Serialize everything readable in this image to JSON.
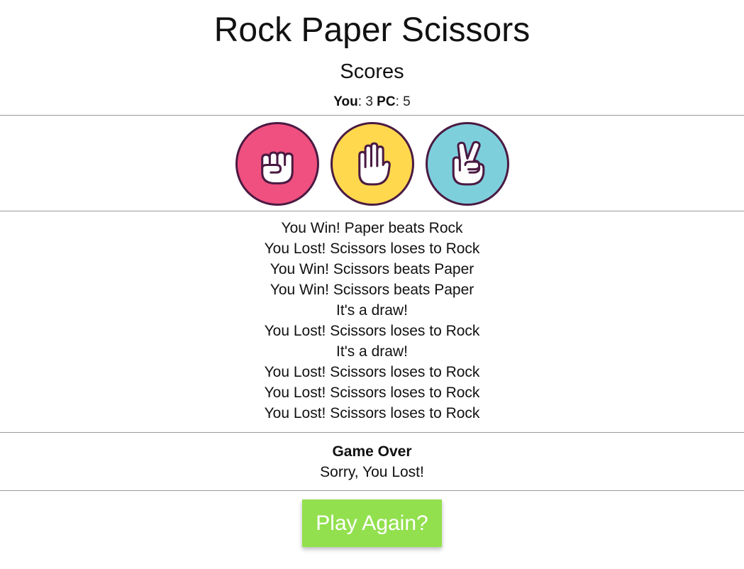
{
  "header": {
    "title": "Rock Paper Scissors",
    "scores_heading": "Scores"
  },
  "scores": {
    "you_label": "You",
    "you_value": "3",
    "pc_label": "PC",
    "pc_value": "5"
  },
  "choices": [
    {
      "name": "rock",
      "icon": "fist-icon",
      "color": "#f0507f"
    },
    {
      "name": "paper",
      "icon": "open-hand-icon",
      "color": "#ffd84d"
    },
    {
      "name": "scissors",
      "icon": "peace-sign-icon",
      "color": "#7ecfdc"
    }
  ],
  "log": [
    "You Win! Paper beats Rock",
    "You Lost! Scissors loses to Rock",
    "You Win! Scissors beats Paper",
    "You Win! Scissors beats Paper",
    "It's a draw!",
    "You Lost! Scissors loses to Rock",
    "It's a draw!",
    "You Lost! Scissors loses to Rock",
    "You Lost! Scissors loses to Rock",
    "You Lost! Scissors loses to Rock"
  ],
  "result": {
    "title": "Game Over",
    "message": "Sorry, You Lost!"
  },
  "play_again": {
    "label": "Play Again?",
    "color": "#92e04e"
  },
  "colors": {
    "icon_outline": "#4a1a42",
    "divider": "#9a9a9a"
  }
}
